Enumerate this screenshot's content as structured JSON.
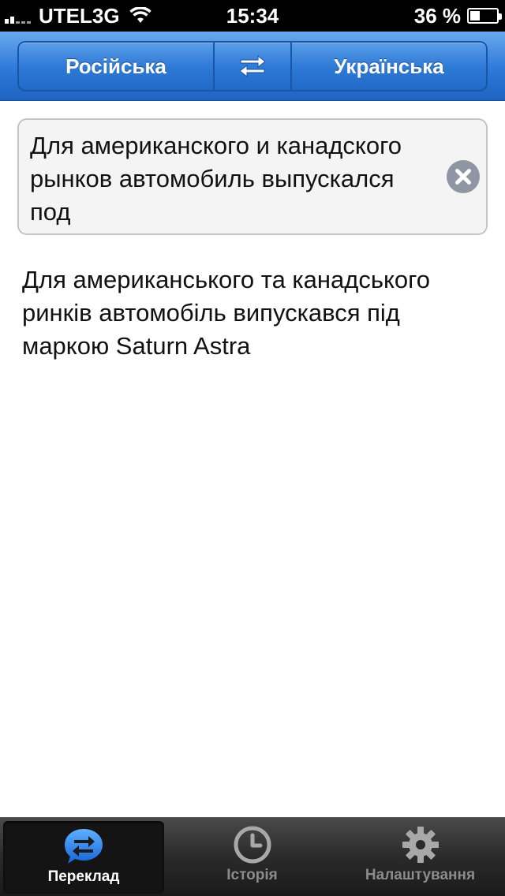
{
  "status_bar": {
    "carrier": "UTEL3G",
    "time": "15:34",
    "battery": "36 %",
    "battery_level": 0.36
  },
  "language_bar": {
    "source_language": "Російська",
    "target_language": "Українська"
  },
  "input": {
    "text": "Для американского и канадского рынков автомобиль выпускался под"
  },
  "output": {
    "text": "Для американського та канадського ринків автомобіль випускався під маркою Saturn Astra"
  },
  "tab_bar": {
    "tabs": [
      {
        "label": "Переклад",
        "icon": "translate-icon",
        "active": true
      },
      {
        "label": "Історія",
        "icon": "clock-icon",
        "active": false
      },
      {
        "label": "Налаштування",
        "icon": "gear-icon",
        "active": false
      }
    ]
  },
  "colors": {
    "accent": "#2f7bd8",
    "tab_bar_bg": "#2a2a2a"
  }
}
